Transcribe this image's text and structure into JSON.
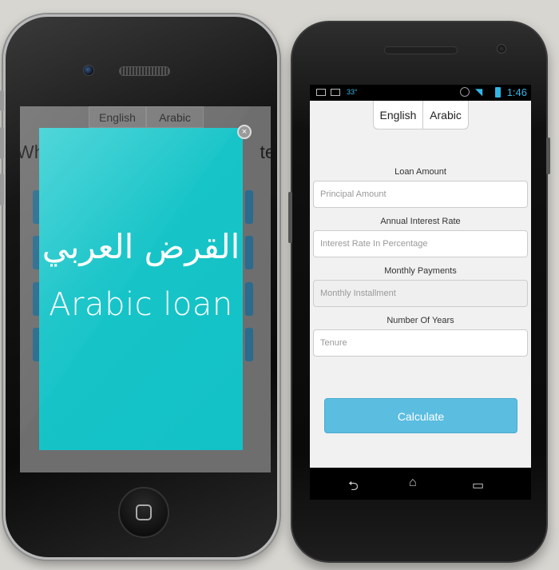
{
  "iphone": {
    "tabs": [
      "English",
      "Arabic"
    ],
    "heading_left": "Wh",
    "heading_right": "te?",
    "splash": {
      "title_arabic": "القرض العربي",
      "title_english": "Arabic loan",
      "close_glyph": "×",
      "bg_color": "#17c4c8"
    }
  },
  "android": {
    "status": {
      "temperature": "33°",
      "time": "1:46",
      "accent": "#33b5e5"
    },
    "tabs": {
      "english": "English",
      "arabic": "Arabic"
    },
    "form": {
      "loan_amount": {
        "label": "Loan Amount",
        "placeholder": "Principal Amount"
      },
      "interest_rate": {
        "label": "Annual Interest Rate",
        "placeholder": "Interest Rate In Percentage"
      },
      "monthly_payments": {
        "label": "Monthly Payments",
        "placeholder": "Monthly Installment"
      },
      "years": {
        "label": "Number Of Years",
        "placeholder": "Tenure"
      }
    },
    "calculate_label": "Calculate",
    "calculate_color": "#5bbde0",
    "nav": {
      "back_icon": "back-icon",
      "home_icon": "home-icon",
      "recents_icon": "recents-icon"
    }
  }
}
